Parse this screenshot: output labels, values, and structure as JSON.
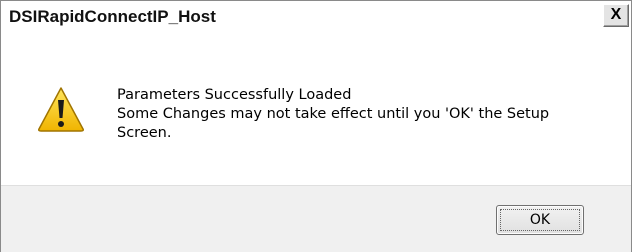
{
  "window": {
    "title": "DSIRapidConnectIP_Host",
    "close_label": "X"
  },
  "message": {
    "icon": "warning-icon",
    "line1": "Parameters Successfully Loaded",
    "line2": "Some Changes may not take effect until you 'OK' the Setup",
    "line3": "Screen."
  },
  "buttons": {
    "ok_label": "OK"
  },
  "colors": {
    "warning_fill": "#f5c000",
    "warning_outline": "#a07400"
  }
}
